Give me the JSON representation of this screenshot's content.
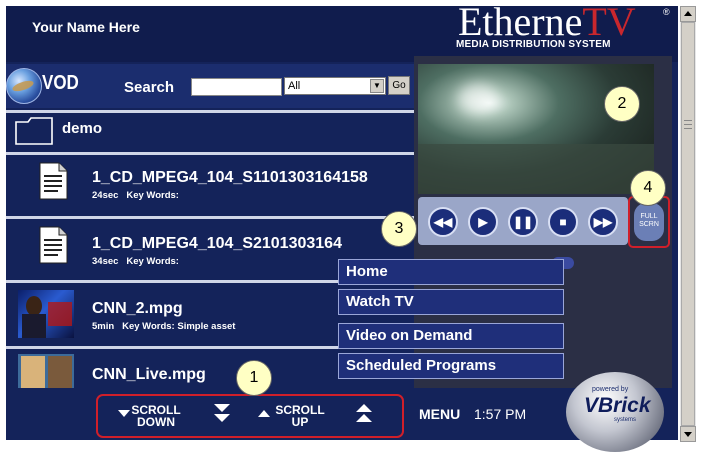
{
  "header": {
    "username": "Your Name Here",
    "logo_main": "Etherne",
    "logo_tv": "TV",
    "logo_reg": "®",
    "logo_subtitle": "MEDIA DISTRIBUTION SYSTEM"
  },
  "toolbar": {
    "vod_label": "VOD",
    "search_label": "Search",
    "search_value": "",
    "filter_selected": "All",
    "go_label": "Go"
  },
  "folder": {
    "label": "demo"
  },
  "items": [
    {
      "title": "1_CD_MPEG4_104_S1101303164158",
      "duration": "24sec",
      "keywords_label": "Key Words:",
      "keywords": ""
    },
    {
      "title": "1_CD_MPEG4_104_S2101303164",
      "duration": "34sec",
      "keywords_label": "Key Words:",
      "keywords": ""
    },
    {
      "title": "CNN_2.mpg",
      "duration": "5min",
      "keywords_label": "Key Words:",
      "keywords": "Simple asset"
    },
    {
      "title": "CNN_Live.mpg",
      "duration": "",
      "keywords_label": "",
      "keywords": ""
    }
  ],
  "player": {
    "fullscreen_label_1": "FULL",
    "fullscreen_label_2": "SCRN",
    "buttons": [
      "rewind-icon",
      "play-icon",
      "pause-icon",
      "stop-icon",
      "fast-forward-icon"
    ]
  },
  "menu": {
    "items": [
      "Home",
      "Watch TV",
      "Video on Demand",
      "Scheduled Programs"
    ]
  },
  "footer": {
    "scroll_down_1": "SCROLL",
    "scroll_down_2": "DOWN",
    "scroll_up_1": "SCROLL",
    "scroll_up_2": "UP",
    "menu_label": "MENU",
    "time": "1:57 PM",
    "vbrick_powered": "powered by",
    "vbrick_name": "VBrick",
    "vbrick_systems": "systems"
  },
  "callouts": [
    "1",
    "2",
    "3",
    "4"
  ],
  "colors": {
    "background": "#14235a",
    "accent_red": "#d01f2a",
    "logo_tv": "#c9272d",
    "callout_fill": "#ffffc4"
  }
}
